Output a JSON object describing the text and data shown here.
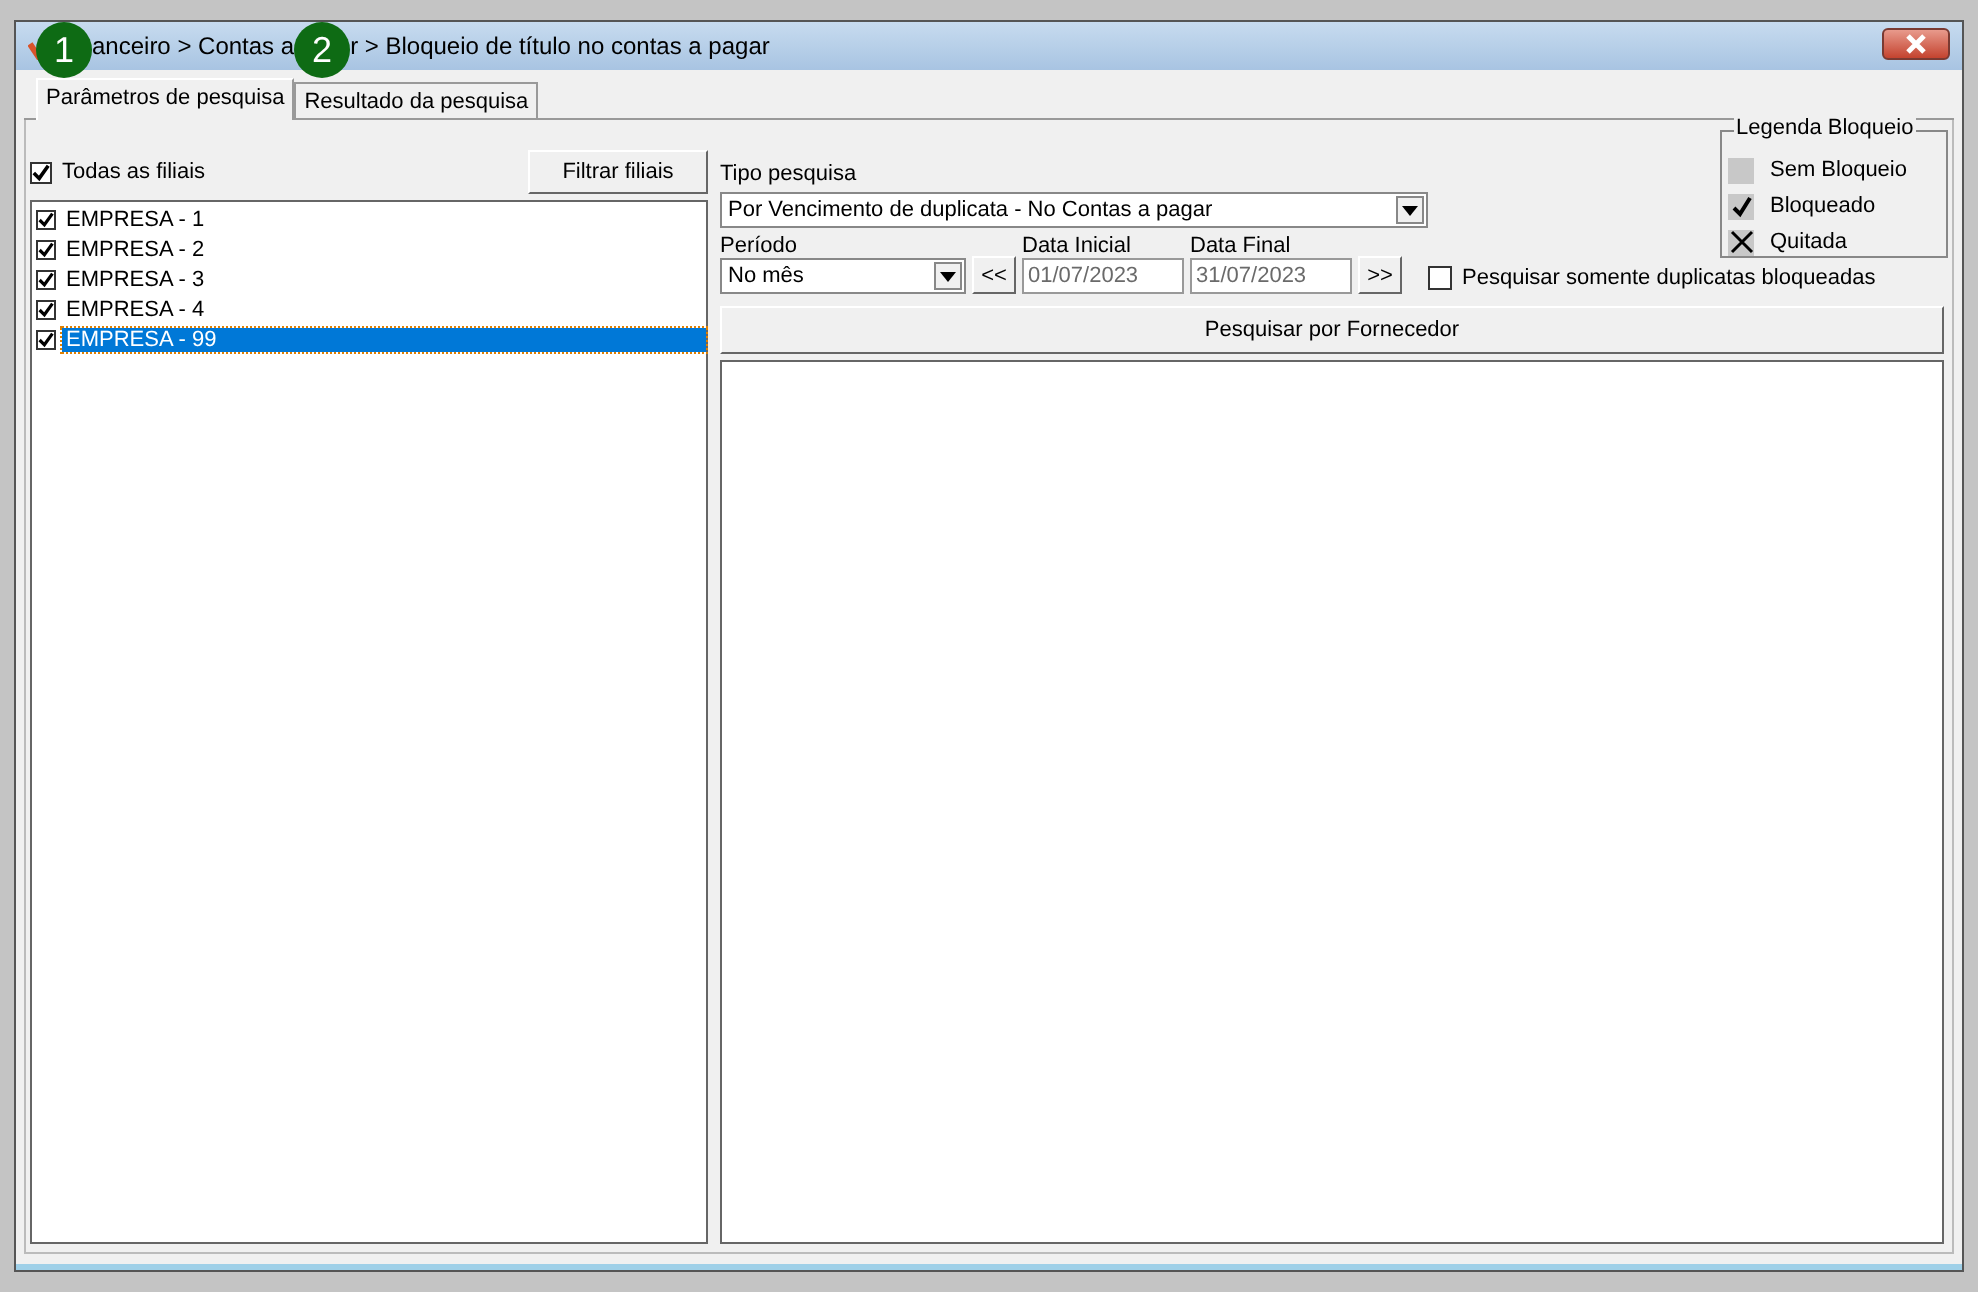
{
  "window": {
    "title_parts": [
      "anceiro > Contas a",
      "r > Bloqueio de título no contas a pagar"
    ],
    "markers": [
      "1",
      "2"
    ]
  },
  "tabs": [
    {
      "label": "Parâmetros de pesquisa",
      "selected": true
    },
    {
      "label": "Resultado da pesquisa",
      "selected": false
    }
  ],
  "filiais": {
    "all": {
      "label": "Todas as filiais",
      "checked": true
    },
    "filter_button": "Filtrar filiais",
    "items": [
      {
        "label": "EMPRESA - 1",
        "checked": true,
        "selected": false
      },
      {
        "label": "EMPRESA - 2",
        "checked": true,
        "selected": false
      },
      {
        "label": "EMPRESA - 3",
        "checked": true,
        "selected": false
      },
      {
        "label": "EMPRESA - 4",
        "checked": true,
        "selected": false
      },
      {
        "label": "EMPRESA - 99",
        "checked": true,
        "selected": true
      }
    ]
  },
  "tipo_pesquisa": {
    "label": "Tipo pesquisa",
    "value": "Por Vencimento de duplicata - No Contas a pagar"
  },
  "periodo": {
    "label": "Período",
    "value": "No mês",
    "prev": "<<",
    "next": ">>"
  },
  "data_inicial": {
    "label": "Data Inicial",
    "value": "01/07/2023"
  },
  "data_final": {
    "label": "Data Final",
    "value": "31/07/2023"
  },
  "somente_bloqueadas": {
    "label": "Pesquisar somente duplicatas bloqueadas",
    "checked": false
  },
  "legend": {
    "title": "Legenda Bloqueio",
    "items": [
      {
        "kind": "none",
        "label": "Sem Bloqueio"
      },
      {
        "kind": "check",
        "label": "Bloqueado"
      },
      {
        "kind": "cross",
        "label": "Quitada"
      }
    ]
  },
  "search_button": "Pesquisar por Fornecedor"
}
